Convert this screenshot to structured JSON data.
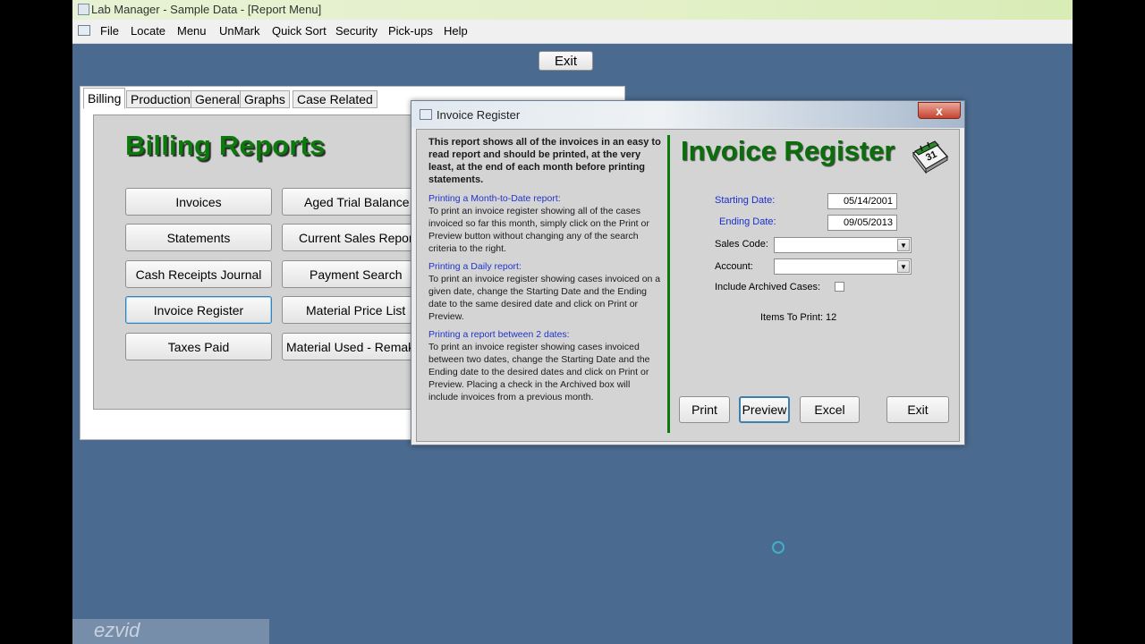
{
  "window": {
    "title": "Lab Manager - Sample Data - [Report Menu]"
  },
  "menu": {
    "items": [
      "File",
      "Locate",
      "Menu",
      "UnMark",
      "Quick Sort",
      "Security",
      "Pick-ups",
      "Help"
    ]
  },
  "top_exit_label": "Exit",
  "tabs": [
    "Billing",
    "Production",
    "General",
    "Graphs",
    "Case Related"
  ],
  "billing": {
    "title": "Billing Reports",
    "buttons": [
      "Invoices",
      "Aged Trial Balance",
      "Statements",
      "Current Sales Report",
      "Cash Receipts Journal",
      "Payment Search",
      "Invoice Register",
      "Material Price List",
      "Taxes Paid",
      "Material Used - Remake"
    ]
  },
  "dialog": {
    "title": "Invoice Register",
    "close_label": "x",
    "heading": "Invoice Register",
    "intro": "This report shows all of the invoices in an easy to read report and should be printed, at the very least, at the end of each month before printing statements.",
    "sections": [
      {
        "heading": "Printing a Month-to-Date report:",
        "text": "To print an invoice register showing all of the cases invoiced so far this month, simply click on the Print or Preview button without changing any of the search criteria to the right."
      },
      {
        "heading": "Printing a Daily report:",
        "text": "To print an invoice register showing cases invoiced on a given date, change the Starting Date and the Ending date to the same desired date and click on Print or Preview."
      },
      {
        "heading": "Printing a report between 2 dates:",
        "text": "To print an invoice register showing cases invoiced between two dates, change the Starting Date and the Ending date to the desired dates and click on Print or Preview.  Placing a check in the Archived box will include invoices from a previous month."
      }
    ],
    "fields": {
      "starting_date_label": "Starting Date:",
      "starting_date": "05/14/2001",
      "ending_date_label": "Ending Date:",
      "ending_date": "09/05/2013",
      "sales_code_label": "Sales Code:",
      "sales_code": "",
      "account_label": "Account:",
      "account": "",
      "include_archived_label": "Include Archived Cases:",
      "items_to_print_label": "Items To Print:",
      "items_to_print": "12"
    },
    "buttons": {
      "print": "Print",
      "preview": "Preview",
      "excel": "Excel",
      "exit": "Exit"
    }
  },
  "watermark": "ezvid"
}
